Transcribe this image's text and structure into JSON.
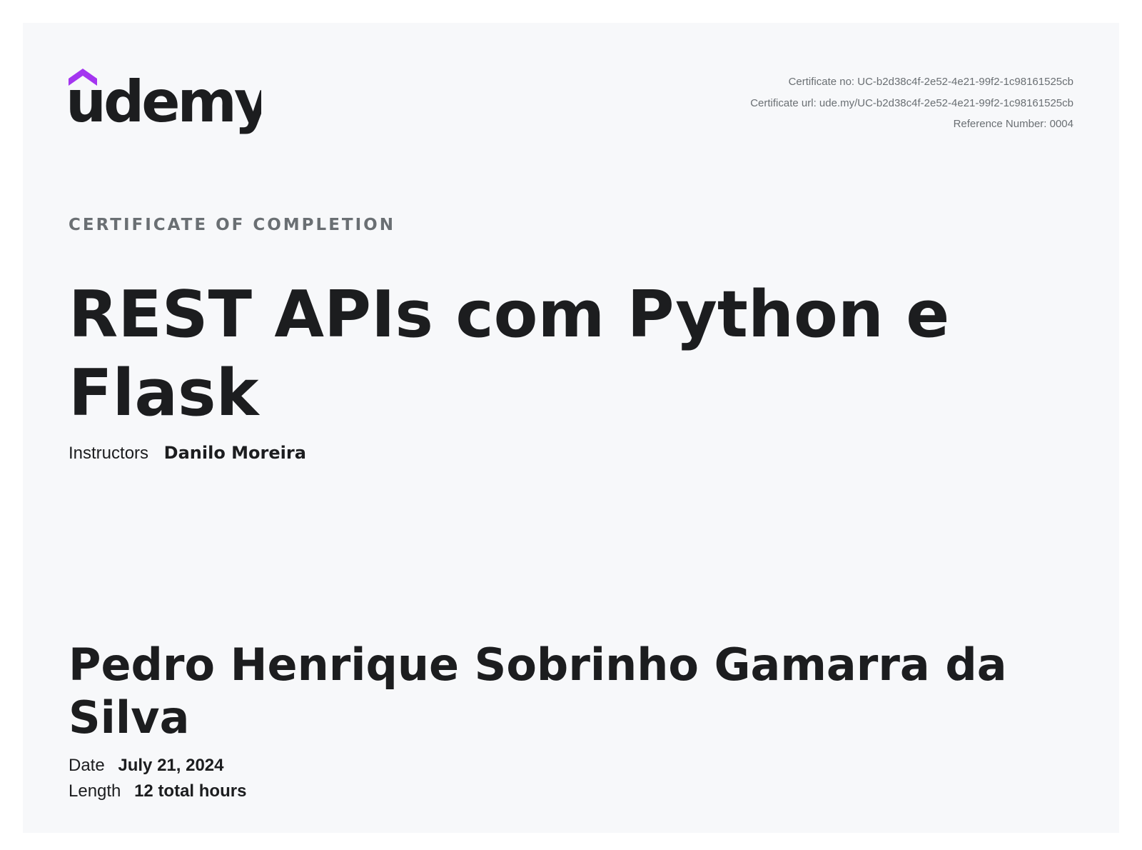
{
  "brand": {
    "name": "udemy",
    "accent_color": "#a435f0",
    "text_color": "#1c1d1f"
  },
  "meta": {
    "certificate_no": "Certificate no: UC-b2d38c4f-2e52-4e21-99f2-1c98161525cb",
    "certificate_url": "Certificate url: ude.my/UC-b2d38c4f-2e52-4e21-99f2-1c98161525cb",
    "reference_number": "Reference Number: 0004"
  },
  "eyebrow": "CERTIFICATE OF COMPLETION",
  "course_title": "REST APIs com Python e Flask",
  "instructors": {
    "label": "Instructors",
    "value": "Danilo Moreira"
  },
  "student_name": "Pedro Henrique Sobrinho Gamarra da Silva",
  "details": {
    "date": {
      "label": "Date",
      "value": "July 21, 2024"
    },
    "length": {
      "label": "Length",
      "value": "12 total hours"
    }
  }
}
